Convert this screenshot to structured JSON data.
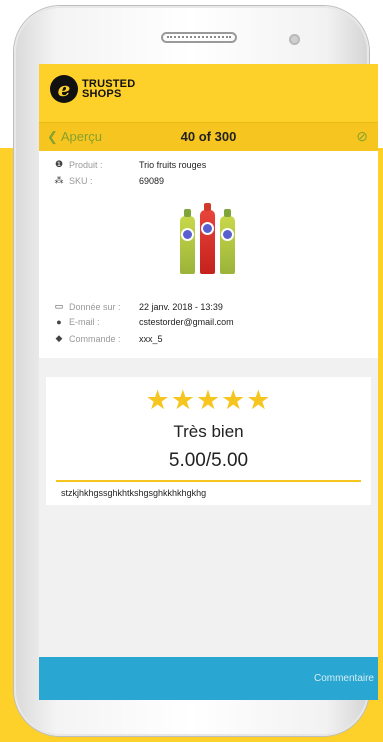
{
  "brand": {
    "logo_letter": "e",
    "name_line1": "TRUSTED",
    "name_line2": "SHOPS"
  },
  "nav": {
    "back_label": "Aperçu",
    "title": "40 of 300",
    "action_icon": "visibility-off-icon"
  },
  "product": {
    "product_label": "Produit :",
    "product_value": "Trio fruits rouges",
    "sku_label": "SKU :",
    "sku_value": "69089",
    "date_label": "Donnée sur :",
    "date_value": "22 janv. 2018 - 13:39",
    "email_label": "E-mail :",
    "email_value": "cstestorder@gmail.com",
    "order_label": "Commande :",
    "order_value": "xxx_5"
  },
  "review": {
    "stars": "★★★★★",
    "rating_value": 5,
    "label": "Très bien",
    "score": "5.00/5.00",
    "comment": "stzkjhkhgssghkhtkshgsghkkhkhgkhg"
  },
  "footer": {
    "comment_button": "Commentaire"
  },
  "colors": {
    "brand_yellow": "#fdd12a",
    "nav_yellow": "#f7c51f",
    "footer_blue": "#29a6d1",
    "star": "#f7c51f"
  }
}
